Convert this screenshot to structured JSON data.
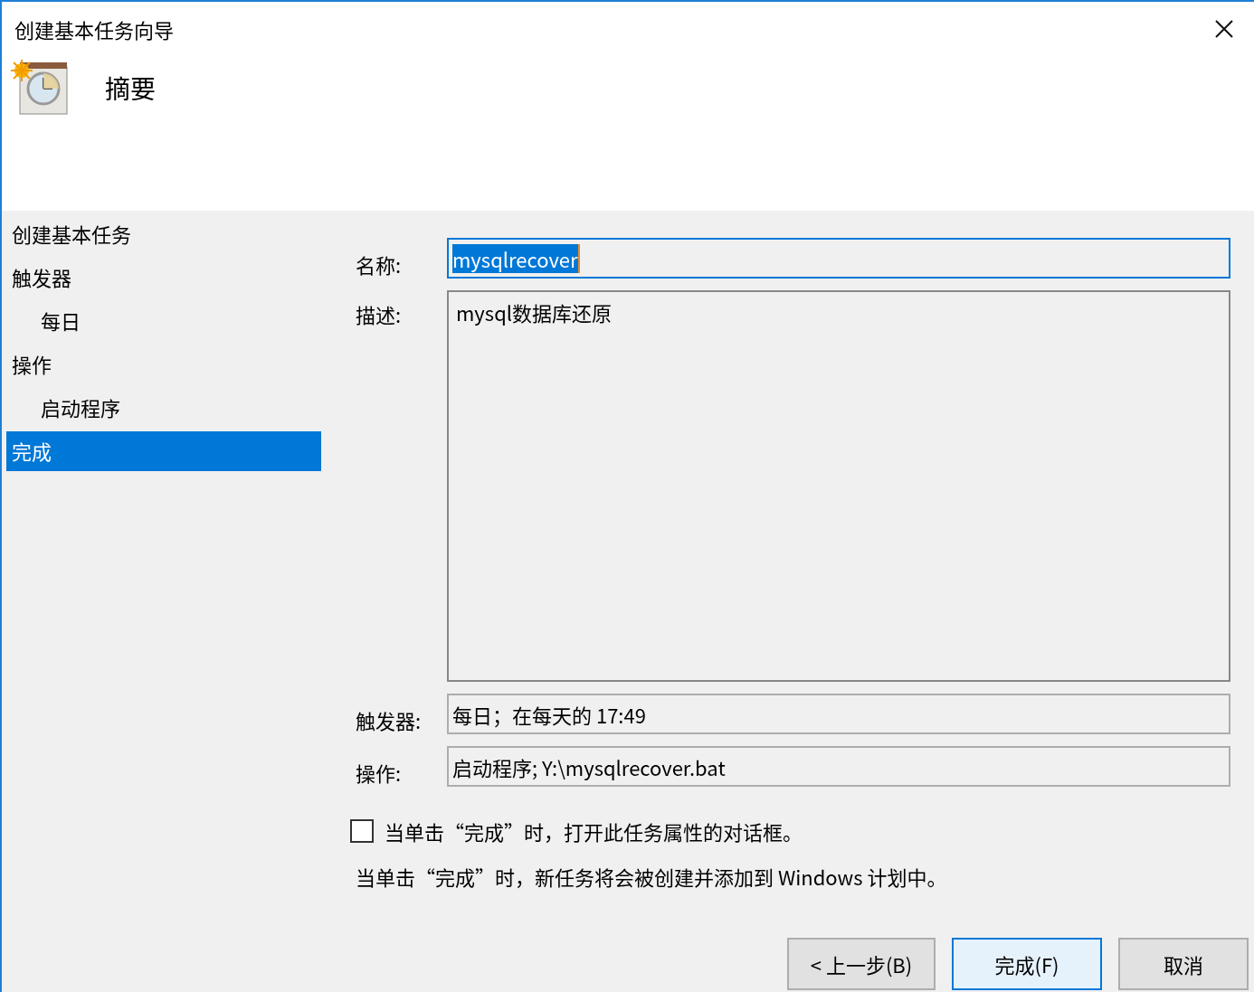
{
  "window": {
    "title": "创建基本任务向导"
  },
  "header": {
    "title": "摘要"
  },
  "steps": [
    {
      "label": "创建基本任务",
      "selected": false
    },
    {
      "label": "触发器",
      "selected": false,
      "children": [
        {
          "label": "每日",
          "selected": false
        }
      ]
    },
    {
      "label": "操作",
      "selected": false,
      "children": [
        {
          "label": "启动程序",
          "selected": false
        }
      ]
    },
    {
      "label": "完成",
      "selected": true
    }
  ],
  "fields": [
    {
      "kind": "name",
      "label": "名称:",
      "value": "mysqlrecover",
      "focused": true
    },
    {
      "kind": "textarea",
      "label": "描述:",
      "value": "mysql数据库还原",
      "focused": false
    },
    {
      "kind": "readonly",
      "label": "触发器:",
      "value": "每日；在每天的 17:49",
      "focused": false
    },
    {
      "kind": "readonly",
      "label": "操作:",
      "value": "启动程序; Y:\\mysqlrecover.bat",
      "focused": false
    }
  ],
  "open_properties": {
    "label": "当单击“完成”时，打开此任务属性的对话框。",
    "checked": false
  },
  "note": "当单击“完成”时，新任务将会被创建并添加到 Windows 计划中。",
  "buttons": [
    {
      "label": "< 上一步(B)",
      "default": false
    },
    {
      "label": "完成(F)",
      "default": true
    },
    {
      "label": "取消",
      "default": false
    }
  ]
}
